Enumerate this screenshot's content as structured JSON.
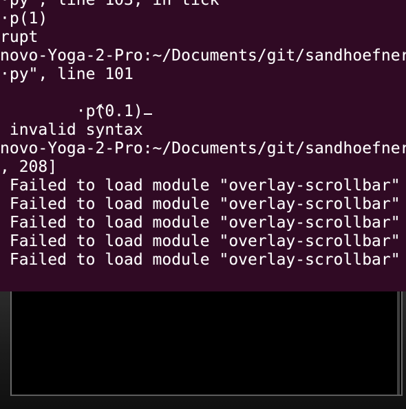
{
  "terminal": {
    "lines": [
      "·py\", line 103, in tick",
      "·p(1)",
      "rupt",
      "novo-Yoga-2-Pro:~/Documents/git/sandhoefner",
      "·py\", line 101",
      "·p(0.1)",
      "          ^",
      " invalid syntax",
      "novo-Yoga-2-Pro:~/Documents/git/sandhoefner",
      ", 208]",
      " Failed to load module \"overlay-scrollbar\"",
      " Failed to load module \"overlay-scrollbar\"",
      " Failed to load module \"overlay-scrollbar\"",
      " Failed to load module \"overlay-scrollbar\"",
      " Failed to load module \"overlay-scrollbar\""
    ]
  },
  "colors": {
    "terminal_background": "#300a24",
    "terminal_text": "#ffffff",
    "window_background": "#000000"
  }
}
